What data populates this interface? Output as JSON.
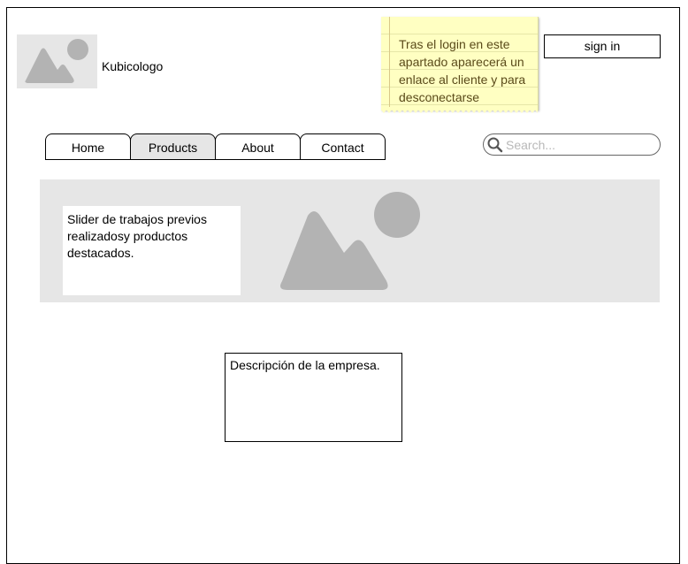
{
  "header": {
    "brand_name": "Kubicologo",
    "logo_icon": "image-placeholder-icon",
    "sign_in_label": "sign in"
  },
  "sticky_note": {
    "text": "Tras el login en este apartado aparecerá un enlace al cliente y para desconectarse"
  },
  "nav": {
    "tabs": [
      {
        "label": "Home",
        "active": false
      },
      {
        "label": "Products",
        "active": true
      },
      {
        "label": "About",
        "active": false
      },
      {
        "label": "Contact",
        "active": false
      }
    ]
  },
  "search": {
    "placeholder": "Search...",
    "value": "",
    "icon": "search-icon"
  },
  "hero": {
    "text": "Slider de trabajos previos realizadosy productos destacados.",
    "image_icon": "image-placeholder-icon"
  },
  "description": {
    "text": "Descripción de la empresa."
  },
  "colors": {
    "placeholder_gray": "#e6e6e6",
    "icon_gray": "#b3b3b3",
    "note_yellow": "#ffffc2",
    "active_tab": "#e6e6e6"
  }
}
